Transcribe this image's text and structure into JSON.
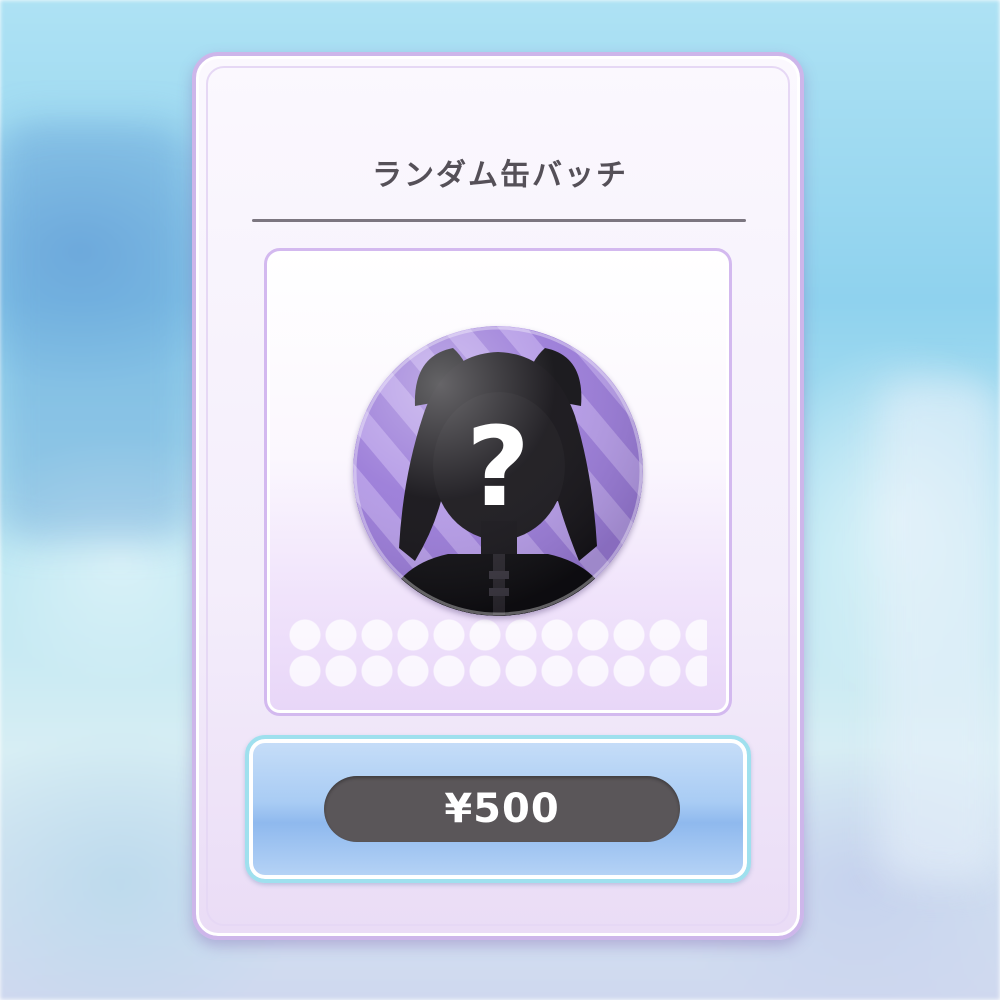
{
  "product": {
    "title": "ランダム缶バッチ",
    "mystery_symbol": "?",
    "price_label": "¥500"
  },
  "icons": {
    "badge": "mystery-silhouette-badge"
  },
  "colors": {
    "card_border": "#cdb6ea",
    "badge_purple": "#a98ae0",
    "button_blue": "#8fb9ee",
    "price_pill": "#5a5659",
    "title_text": "#555058"
  }
}
